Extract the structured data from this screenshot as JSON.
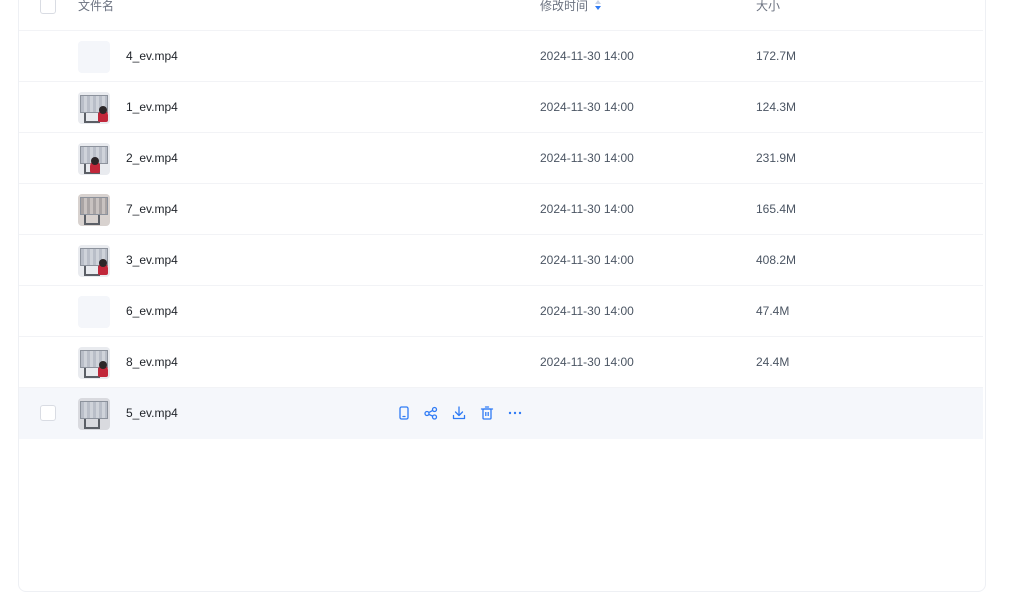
{
  "header": {
    "name_label": "文件名",
    "mtime_label": "修改时间",
    "size_label": "大小"
  },
  "files": [
    {
      "name": "4_ev.mp4",
      "mtime": "2024-11-30 14:00",
      "size": "172.7M",
      "thumbnail": "blank"
    },
    {
      "name": "1_ev.mp4",
      "mtime": "2024-11-30 14:00",
      "size": "124.3M",
      "thumbnail": "video"
    },
    {
      "name": "2_ev.mp4",
      "mtime": "2024-11-30 14:00",
      "size": "231.9M",
      "thumbnail": "video"
    },
    {
      "name": "7_ev.mp4",
      "mtime": "2024-11-30 14:00",
      "size": "165.4M",
      "thumbnail": "video"
    },
    {
      "name": "3_ev.mp4",
      "mtime": "2024-11-30 14:00",
      "size": "408.2M",
      "thumbnail": "video"
    },
    {
      "name": "6_ev.mp4",
      "mtime": "2024-11-30 14:00",
      "size": "47.4M",
      "thumbnail": "blank"
    },
    {
      "name": "8_ev.mp4",
      "mtime": "2024-11-30 14:00",
      "size": "24.4M",
      "thumbnail": "video"
    },
    {
      "name": "5_ev.mp4",
      "mtime": "",
      "size": "",
      "thumbnail": "video"
    }
  ],
  "hover_actions": [
    "phone-icon",
    "share-icon",
    "download-icon",
    "delete-icon",
    "more-icon"
  ],
  "colors": {
    "accent": "#2f7bf5",
    "hover_row": "#f5f7fb",
    "text_primary": "#1f2329",
    "text_secondary": "#4b5563"
  }
}
